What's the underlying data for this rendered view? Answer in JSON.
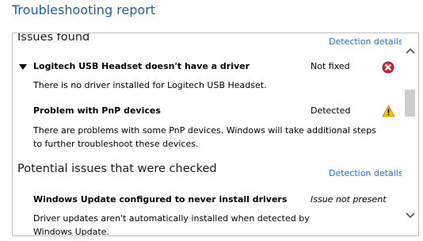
{
  "report": {
    "title": "Troubleshooting report"
  },
  "sections": [
    {
      "heading": "Issues found",
      "details_link": "Detection details",
      "issues": [
        {
          "title": "Logitech USB Headset doesn't have a driver",
          "status": "Not fixed",
          "status_icon": "error-icon",
          "expanded": true,
          "description": "There is no driver installed for Logitech USB Headset."
        },
        {
          "title": "Problem with PnP devices",
          "status": "Detected",
          "status_icon": "warning-icon",
          "description": "There are problems with some PnP devices. Windows will take additional steps to further troubleshoot these devices."
        }
      ]
    },
    {
      "heading": "Potential issues that were checked",
      "details_link": "Detection details",
      "issues": [
        {
          "title": "Windows Update configured to never install drivers",
          "status": "Issue not present",
          "description": "Driver updates aren't automatically installed when detected by Windows Update."
        }
      ]
    }
  ],
  "colors": {
    "title": "#1e5ea8",
    "link": "#1e6fcc",
    "error": "#c8283c",
    "warning": "#f2c200"
  }
}
